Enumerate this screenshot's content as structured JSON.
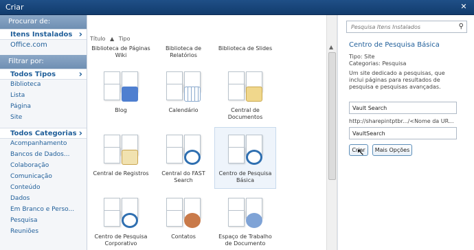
{
  "window": {
    "title": "Criar",
    "close_glyph": "✕"
  },
  "sidebar": {
    "browse_header": "Procurar de:",
    "browse_items": [
      "Itens Instalados",
      "Office.com"
    ],
    "filter_header": "Filtrar por:",
    "types": [
      "Todos Tipos",
      "Biblioteca",
      "Lista",
      "Página",
      "Site"
    ],
    "categories": [
      "Todos Categorias",
      "Acompanhamento",
      "Bancos de Dados...",
      "Colaboração",
      "Comunicação",
      "Conteúdo",
      "Dados",
      "Em Branco e Perso...",
      "Pesquisa",
      "Reuniões"
    ]
  },
  "main": {
    "sort_title": "Título",
    "sort_type": "Tipo",
    "sort_arrow": "▲",
    "top_row": [
      "Biblioteca de Páginas Wiki",
      "Biblioteca de Relatórios",
      "Biblioteca de Slides"
    ],
    "tiles": [
      {
        "label": "Blog",
        "icon": "blog-icon"
      },
      {
        "label": "Calendário",
        "icon": "calendar-icon"
      },
      {
        "label": "Central de Documentos",
        "icon": "folder-icon"
      },
      {
        "label": "Central de Registros",
        "icon": "records-lock-icon"
      },
      {
        "label": "Central do FAST Search",
        "icon": "fast-search-icon"
      },
      {
        "label": "Centro de Pesquisa Básica",
        "icon": "basic-search-icon"
      },
      {
        "label": "Centro de Pesquisa Corporativo",
        "icon": "corporate-search-icon"
      },
      {
        "label": "Contatos",
        "icon": "contacts-icon"
      },
      {
        "label": "Espaço de Trabalho de Documento",
        "icon": "document-workspace-icon"
      }
    ]
  },
  "details": {
    "search_placeholder": "Pesquisa Itens Instalados",
    "search_icon": "search-icon",
    "title": "Centro de Pesquisa Básica",
    "type_line": "Tipo: Site",
    "categories_line": "Categorias: Pesquisa",
    "description_lines": [
      "Um site dedicado a pesquisas, que",
      "inclui páginas para resultados de",
      "pesquisa e pesquisas avançadas."
    ],
    "name_value": "Vault Search",
    "url_prefix": "http://sharepintptbr.../<Nome da UR...",
    "url_value": "VaultSearch",
    "create_label": "Criar",
    "more_label": "Mais Opções"
  },
  "colors": {
    "header": "#1f4f87",
    "sidebar_head": "#7f9dc0",
    "link": "#1f5e99",
    "accent_blue": "#3c74c4"
  }
}
